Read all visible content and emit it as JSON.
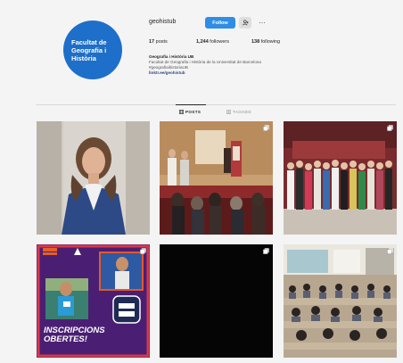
{
  "profile": {
    "avatar_text": "Facultat de Geografia i Història",
    "username": "geohistub",
    "follow_label": "Follow",
    "suggest_icon": "person-add-icon",
    "more_icon": "ellipsis-icon",
    "more_label": "···"
  },
  "stats": {
    "posts_count": "17",
    "posts_label": "posts",
    "followers_count": "1,244",
    "followers_label": "followers",
    "following_count": "138",
    "following_label": "following"
  },
  "bio": {
    "name": "Geografia i Història UB",
    "line1": "Facultat de Geografia i Història de la Universitat de Barcelona",
    "line2": "#geografiaihistoriaUB",
    "link": "linktr.ee/geohistub"
  },
  "tabs": [
    {
      "label": "POSTS",
      "icon": "grid-icon",
      "active": true
    },
    {
      "label": "TAGGED",
      "icon": "tag-icon",
      "active": false
    }
  ],
  "posts": [
    {
      "subject": "portrait"
    },
    {
      "subject": "lecture-hall-speakers",
      "multi": true
    },
    {
      "subject": "group-photo-on-stage",
      "multi": true
    },
    {
      "subject": "registration-promo",
      "text": "INSCRIPCIONS OBERTES!",
      "logo": "UNI SPORT UB",
      "multi": true
    },
    {
      "subject": "black-frame",
      "multi": true
    },
    {
      "subject": "classroom-students",
      "multi": true
    }
  ]
}
